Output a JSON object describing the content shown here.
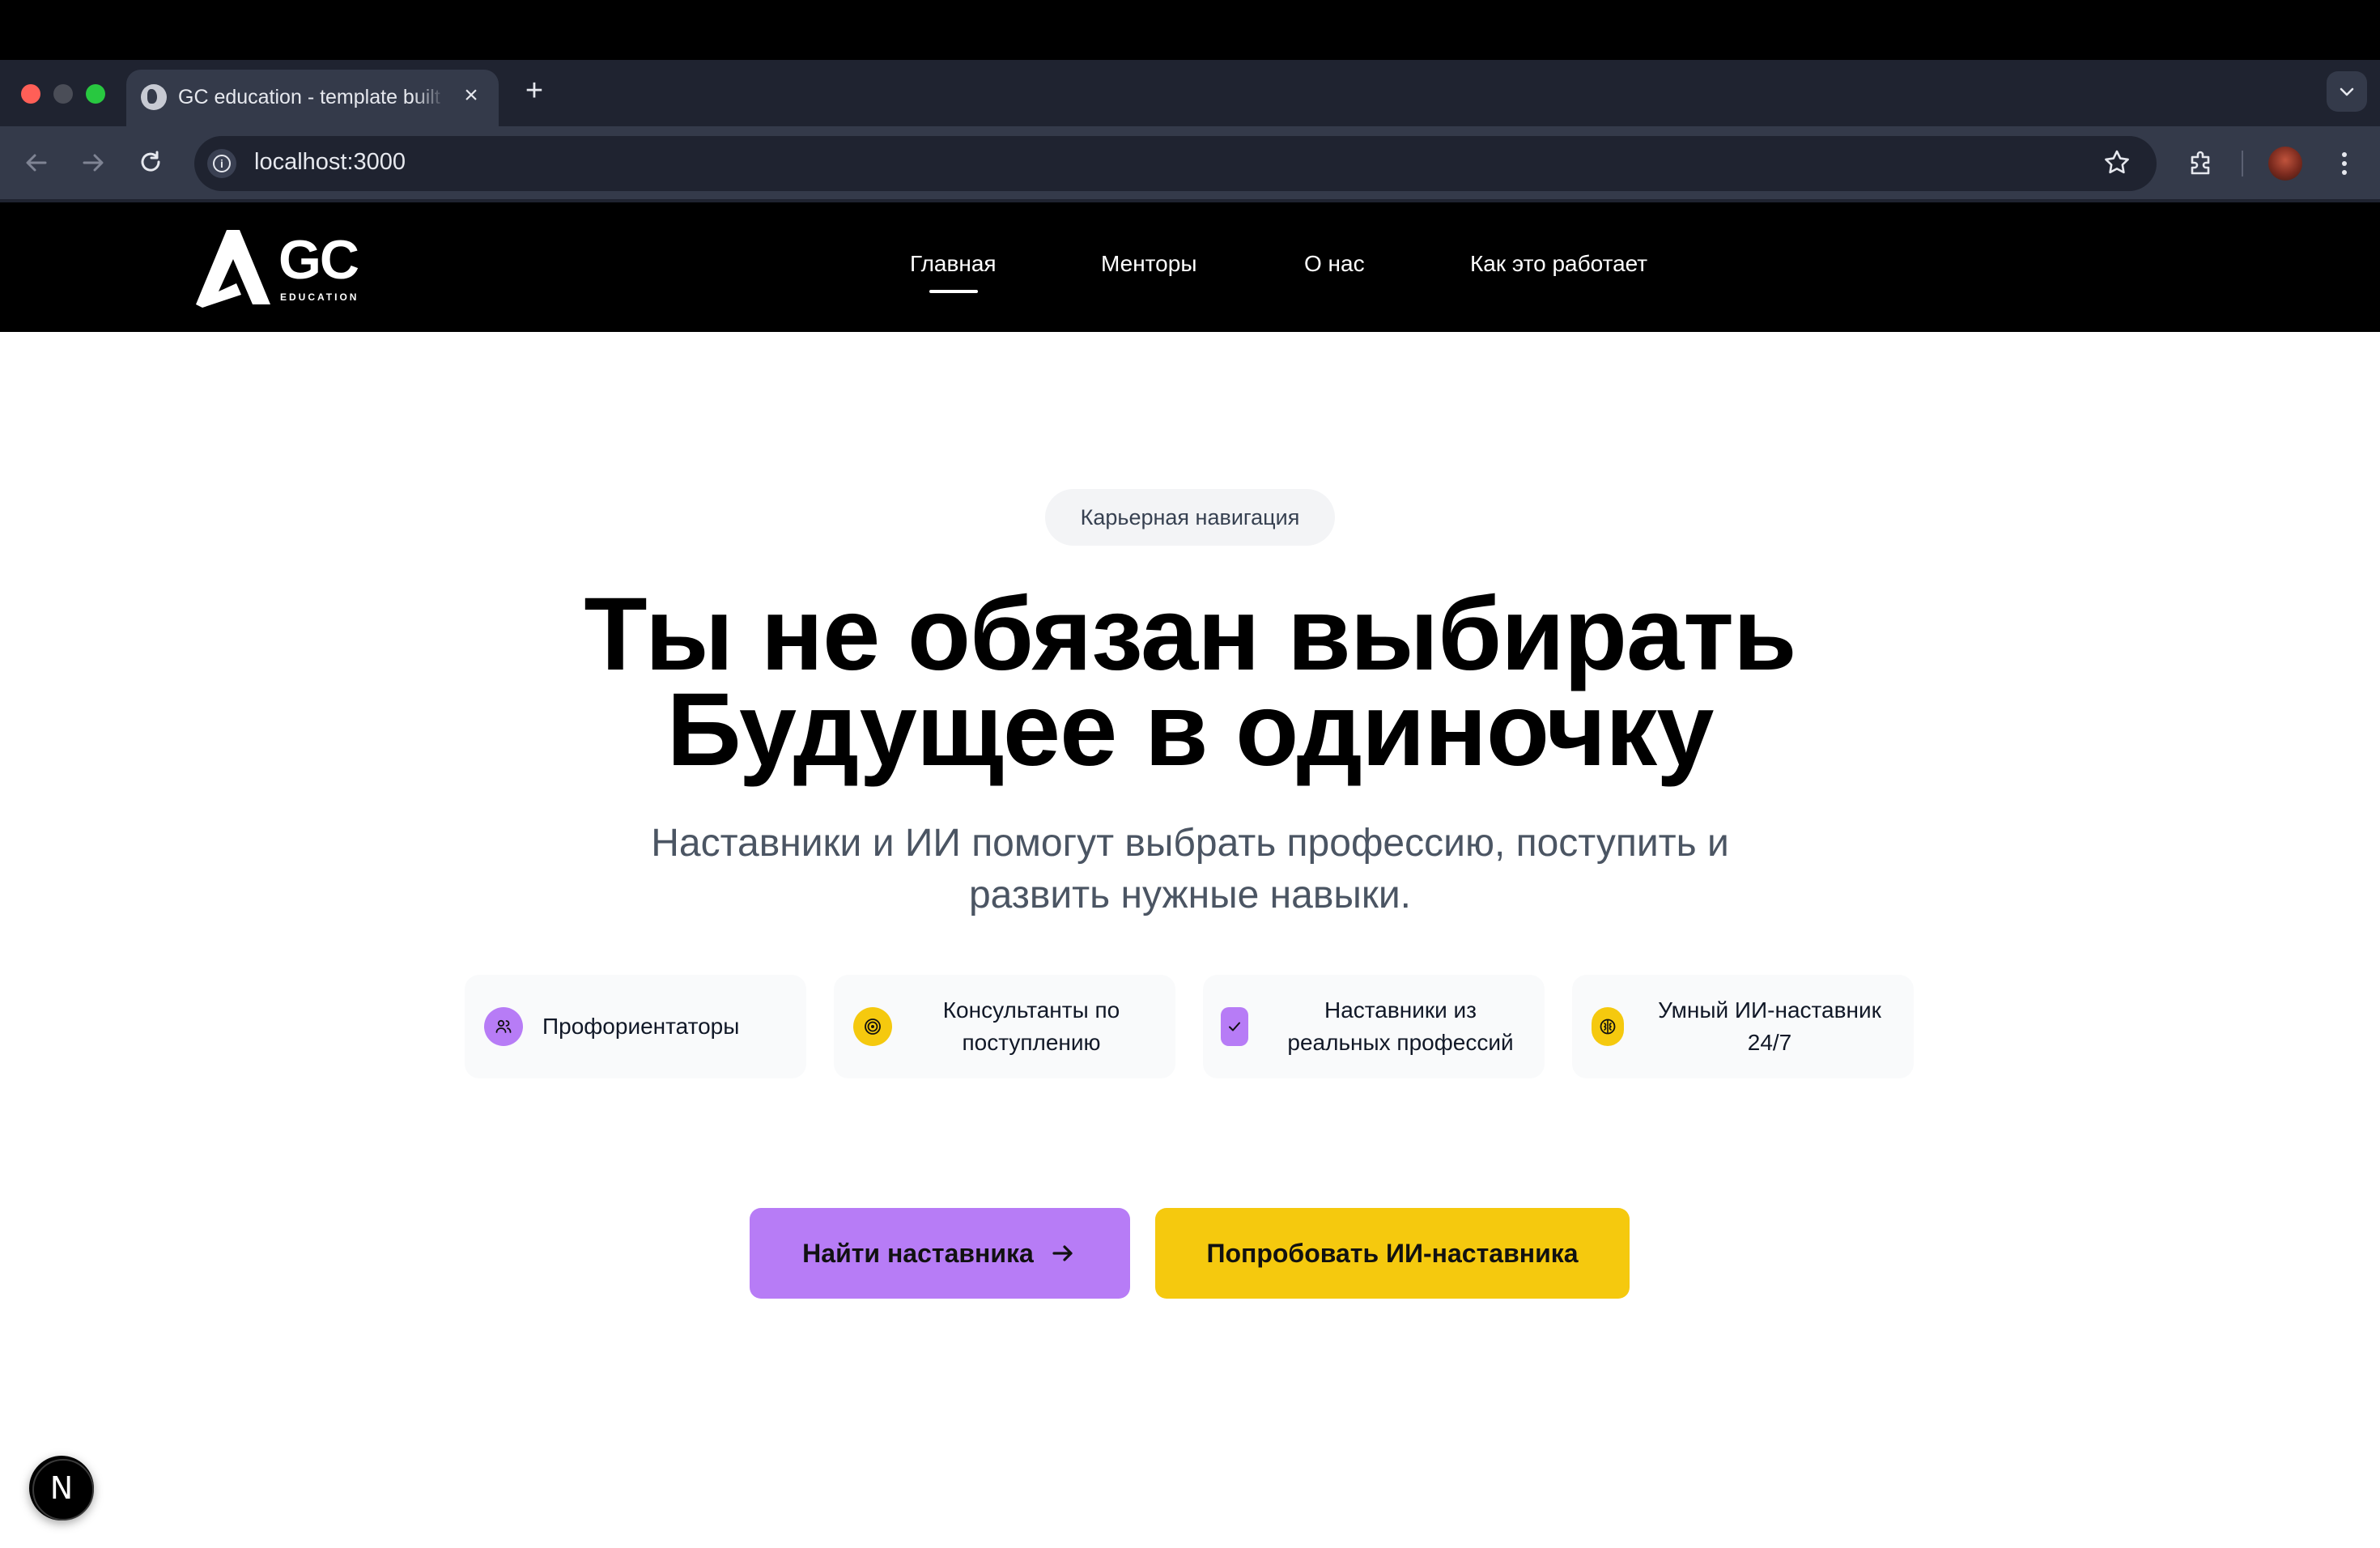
{
  "browser": {
    "tab_title": "GC education - template built with ...",
    "url": "localhost:3000",
    "new_tab_symbol": "+",
    "close_symbol": "×"
  },
  "site": {
    "logo": {
      "mark": "GC",
      "sub": "EDUCATION"
    },
    "nav": [
      {
        "label": "Главная",
        "active": true
      },
      {
        "label": "Менторы"
      },
      {
        "label": "О нас"
      },
      {
        "label": "Как это работает"
      }
    ]
  },
  "hero": {
    "badge": "Карьерная навигация",
    "title_line1": "Ты не обязан выбирать",
    "title_line2": "Будущее в одиночку",
    "subtitle_line1": "Наставники и ИИ помогут выбрать профессию, поступить и",
    "subtitle_line2": "развить нужные навыки.",
    "features": [
      {
        "label": "Профориентаторы",
        "icon": "users-icon",
        "color": "#b77cf6"
      },
      {
        "label": "Консультанты по поступлению",
        "icon": "target-icon",
        "color": "#f5c90e"
      },
      {
        "label": "Наставники из реальных профессий",
        "icon": "check-icon",
        "color": "#b77cf6"
      },
      {
        "label": "Умный ИИ-наставник 24/7",
        "icon": "brain-icon",
        "color": "#f5c90e"
      }
    ],
    "cta_primary": "Найти наставника",
    "cta_secondary": "Попробовать ИИ-наставника"
  },
  "dev_badge": "N",
  "colors": {
    "accent_purple": "#b77cf6",
    "accent_yellow": "#f5c90e",
    "header_bg": "#000000"
  }
}
